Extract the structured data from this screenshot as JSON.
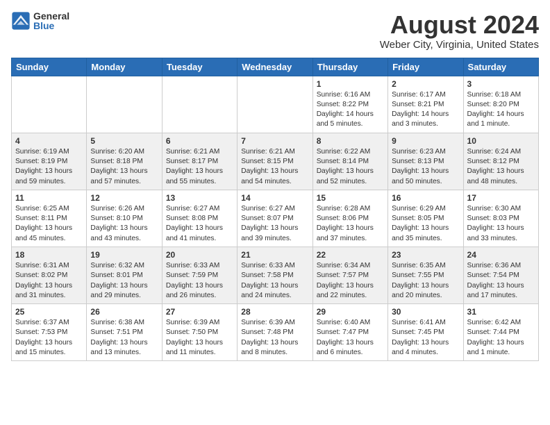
{
  "logo": {
    "general": "General",
    "blue": "Blue"
  },
  "title": "August 2024",
  "subtitle": "Weber City, Virginia, United States",
  "days_of_week": [
    "Sunday",
    "Monday",
    "Tuesday",
    "Wednesday",
    "Thursday",
    "Friday",
    "Saturday"
  ],
  "weeks": [
    [
      {
        "day": "",
        "info": ""
      },
      {
        "day": "",
        "info": ""
      },
      {
        "day": "",
        "info": ""
      },
      {
        "day": "",
        "info": ""
      },
      {
        "day": "1",
        "info": "Sunrise: 6:16 AM\nSunset: 8:22 PM\nDaylight: 14 hours\nand 5 minutes."
      },
      {
        "day": "2",
        "info": "Sunrise: 6:17 AM\nSunset: 8:21 PM\nDaylight: 14 hours\nand 3 minutes."
      },
      {
        "day": "3",
        "info": "Sunrise: 6:18 AM\nSunset: 8:20 PM\nDaylight: 14 hours\nand 1 minute."
      }
    ],
    [
      {
        "day": "4",
        "info": "Sunrise: 6:19 AM\nSunset: 8:19 PM\nDaylight: 13 hours\nand 59 minutes."
      },
      {
        "day": "5",
        "info": "Sunrise: 6:20 AM\nSunset: 8:18 PM\nDaylight: 13 hours\nand 57 minutes."
      },
      {
        "day": "6",
        "info": "Sunrise: 6:21 AM\nSunset: 8:17 PM\nDaylight: 13 hours\nand 55 minutes."
      },
      {
        "day": "7",
        "info": "Sunrise: 6:21 AM\nSunset: 8:15 PM\nDaylight: 13 hours\nand 54 minutes."
      },
      {
        "day": "8",
        "info": "Sunrise: 6:22 AM\nSunset: 8:14 PM\nDaylight: 13 hours\nand 52 minutes."
      },
      {
        "day": "9",
        "info": "Sunrise: 6:23 AM\nSunset: 8:13 PM\nDaylight: 13 hours\nand 50 minutes."
      },
      {
        "day": "10",
        "info": "Sunrise: 6:24 AM\nSunset: 8:12 PM\nDaylight: 13 hours\nand 48 minutes."
      }
    ],
    [
      {
        "day": "11",
        "info": "Sunrise: 6:25 AM\nSunset: 8:11 PM\nDaylight: 13 hours\nand 45 minutes."
      },
      {
        "day": "12",
        "info": "Sunrise: 6:26 AM\nSunset: 8:10 PM\nDaylight: 13 hours\nand 43 minutes."
      },
      {
        "day": "13",
        "info": "Sunrise: 6:27 AM\nSunset: 8:08 PM\nDaylight: 13 hours\nand 41 minutes."
      },
      {
        "day": "14",
        "info": "Sunrise: 6:27 AM\nSunset: 8:07 PM\nDaylight: 13 hours\nand 39 minutes."
      },
      {
        "day": "15",
        "info": "Sunrise: 6:28 AM\nSunset: 8:06 PM\nDaylight: 13 hours\nand 37 minutes."
      },
      {
        "day": "16",
        "info": "Sunrise: 6:29 AM\nSunset: 8:05 PM\nDaylight: 13 hours\nand 35 minutes."
      },
      {
        "day": "17",
        "info": "Sunrise: 6:30 AM\nSunset: 8:03 PM\nDaylight: 13 hours\nand 33 minutes."
      }
    ],
    [
      {
        "day": "18",
        "info": "Sunrise: 6:31 AM\nSunset: 8:02 PM\nDaylight: 13 hours\nand 31 minutes."
      },
      {
        "day": "19",
        "info": "Sunrise: 6:32 AM\nSunset: 8:01 PM\nDaylight: 13 hours\nand 29 minutes."
      },
      {
        "day": "20",
        "info": "Sunrise: 6:33 AM\nSunset: 7:59 PM\nDaylight: 13 hours\nand 26 minutes."
      },
      {
        "day": "21",
        "info": "Sunrise: 6:33 AM\nSunset: 7:58 PM\nDaylight: 13 hours\nand 24 minutes."
      },
      {
        "day": "22",
        "info": "Sunrise: 6:34 AM\nSunset: 7:57 PM\nDaylight: 13 hours\nand 22 minutes."
      },
      {
        "day": "23",
        "info": "Sunrise: 6:35 AM\nSunset: 7:55 PM\nDaylight: 13 hours\nand 20 minutes."
      },
      {
        "day": "24",
        "info": "Sunrise: 6:36 AM\nSunset: 7:54 PM\nDaylight: 13 hours\nand 17 minutes."
      }
    ],
    [
      {
        "day": "25",
        "info": "Sunrise: 6:37 AM\nSunset: 7:53 PM\nDaylight: 13 hours\nand 15 minutes."
      },
      {
        "day": "26",
        "info": "Sunrise: 6:38 AM\nSunset: 7:51 PM\nDaylight: 13 hours\nand 13 minutes."
      },
      {
        "day": "27",
        "info": "Sunrise: 6:39 AM\nSunset: 7:50 PM\nDaylight: 13 hours\nand 11 minutes."
      },
      {
        "day": "28",
        "info": "Sunrise: 6:39 AM\nSunset: 7:48 PM\nDaylight: 13 hours\nand 8 minutes."
      },
      {
        "day": "29",
        "info": "Sunrise: 6:40 AM\nSunset: 7:47 PM\nDaylight: 13 hours\nand 6 minutes."
      },
      {
        "day": "30",
        "info": "Sunrise: 6:41 AM\nSunset: 7:45 PM\nDaylight: 13 hours\nand 4 minutes."
      },
      {
        "day": "31",
        "info": "Sunrise: 6:42 AM\nSunset: 7:44 PM\nDaylight: 13 hours\nand 1 minute."
      }
    ]
  ]
}
